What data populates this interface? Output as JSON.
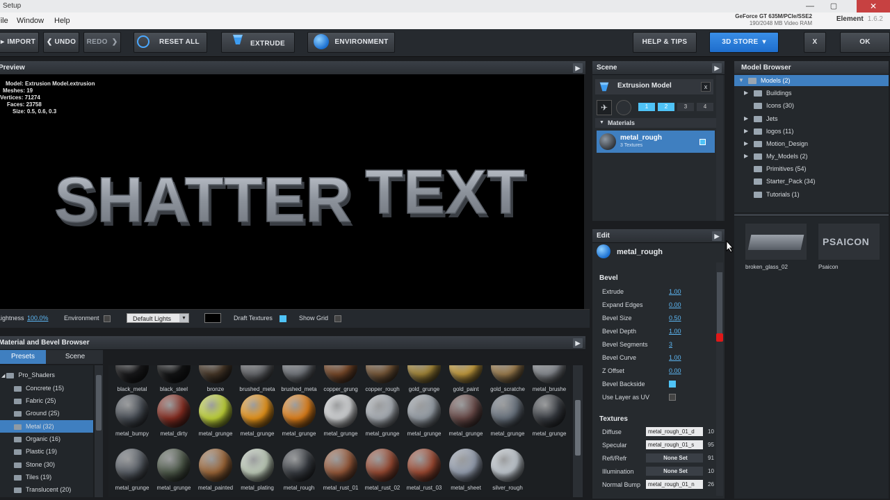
{
  "window": {
    "title": "Setup",
    "close": "✕",
    "minimize": "—",
    "maximize": "▢"
  },
  "menu": [
    "File",
    "Window",
    "Help"
  ],
  "gpu": {
    "line1": "GeForce GT 635M/PCIe/SSE2",
    "line2": "190/2048 MB Video RAM"
  },
  "app": {
    "name": "Element",
    "version": "1.6.2"
  },
  "toolbar": {
    "import": "IMPORT",
    "undo": "UNDO",
    "redo": "REDO",
    "reset_all": "RESET ALL",
    "extrude": "EXTRUDE",
    "environment": "ENVIRONMENT",
    "help": "HELP & TIPS",
    "store": "3D STORE",
    "close": "X",
    "ok": "OK"
  },
  "preview": {
    "header": "Preview",
    "info": {
      "model": "Model: Extrusion Model.extrusion",
      "meshes": "Meshes: 19",
      "vertices": "Vertices: 71274",
      "faces": "Faces: 23758",
      "size": "Size: 0.5, 0.6, 0.3"
    },
    "word1": "SHATTER",
    "word2": "TEXT"
  },
  "viewbar": {
    "lightness_label": "Lightness",
    "lightness_value": "100.0%",
    "environment_label": "Environment",
    "lights_select": "Default Lights",
    "draft_label": "Draft Textures",
    "grid_label": "Show Grid"
  },
  "material_browser": {
    "header": "Material and Bevel Browser",
    "tabs": [
      "Presets",
      "Scene"
    ],
    "root": "Pro_Shaders",
    "folders": [
      "Concrete (15)",
      "Fabric (25)",
      "Ground (25)",
      "Metal (32)",
      "Organic (16)",
      "Plastic (19)",
      "Stone (30)",
      "Tiles (19)",
      "Translucent (20)"
    ],
    "row1": [
      "black_metal",
      "black_steel",
      "bronze",
      "brushed_meta",
      "brushed_meta",
      "copper_grung",
      "copper_rough",
      "gold_grunge",
      "gold_paint",
      "gold_scratche",
      "metal_brushe"
    ],
    "row2": [
      "metal_bumpy",
      "metal_dirty",
      "metal_grunge",
      "metal_grunge",
      "metal_grunge",
      "metal_grunge",
      "metal_grunge",
      "metal_grunge",
      "metal_grunge",
      "metal_grunge",
      "metal_grunge"
    ],
    "row3": [
      "metal_grunge",
      "metal_grunge",
      "metal_painted",
      "metal_plating",
      "metal_rough",
      "metal_rust_01",
      "metal_rust_02",
      "metal_rust_03",
      "metal_sheet",
      "silver_rough"
    ]
  },
  "scene": {
    "header": "Scene",
    "model_name": "Extrusion Model",
    "close": "x",
    "groups": [
      "1",
      "2",
      "3",
      "4"
    ],
    "materials_label": "Materials",
    "material_name": "metal_rough",
    "material_sub": "3 Textures"
  },
  "edit": {
    "header": "Edit",
    "material": "metal_rough",
    "bevel_label": "Bevel",
    "props": [
      {
        "label": "Extrude",
        "value": "1.00"
      },
      {
        "label": "Expand Edges",
        "value": "0.00"
      },
      {
        "label": "Bevel Size",
        "value": "0.50"
      },
      {
        "label": "Bevel Depth",
        "value": "1.00"
      },
      {
        "label": "Bevel Segments",
        "value": "3"
      },
      {
        "label": "Bevel Curve",
        "value": "1.00"
      },
      {
        "label": "Z Offset",
        "value": "0.00"
      }
    ],
    "backside_label": "Bevel Backside",
    "uv_label": "Use Layer as UV",
    "textures_label": "Textures",
    "textures": [
      {
        "label": "Diffuse",
        "value": "metal_rough_01_d",
        "num": "10"
      },
      {
        "label": "Specular",
        "value": "metal_rough_01_s",
        "num": "95"
      },
      {
        "label": "Refl/Refr",
        "value": "None Set",
        "num": "91"
      },
      {
        "label": "Illumination",
        "value": "None Set",
        "num": "10"
      },
      {
        "label": "Normal Bump",
        "value": "metal_rough_01_n",
        "num": "26"
      }
    ]
  },
  "model_browser": {
    "header": "Model Browser",
    "root": "Models (2)",
    "items": [
      "Buildings",
      "Icons (30)",
      "Jets",
      "logos (11)",
      "Motion_Design",
      "My_Models (2)",
      "Primitives (54)",
      "Starter_Pack (34)",
      "Tutorials (1)"
    ],
    "thumbs": [
      {
        "label": "broken_glass_02",
        "text": ""
      },
      {
        "label": "Psaicon",
        "text": "PSAICON"
      }
    ]
  },
  "colors": {
    "accent": "#1e6dcc",
    "selection": "#3f7fc0",
    "background": "#1b1d20"
  }
}
